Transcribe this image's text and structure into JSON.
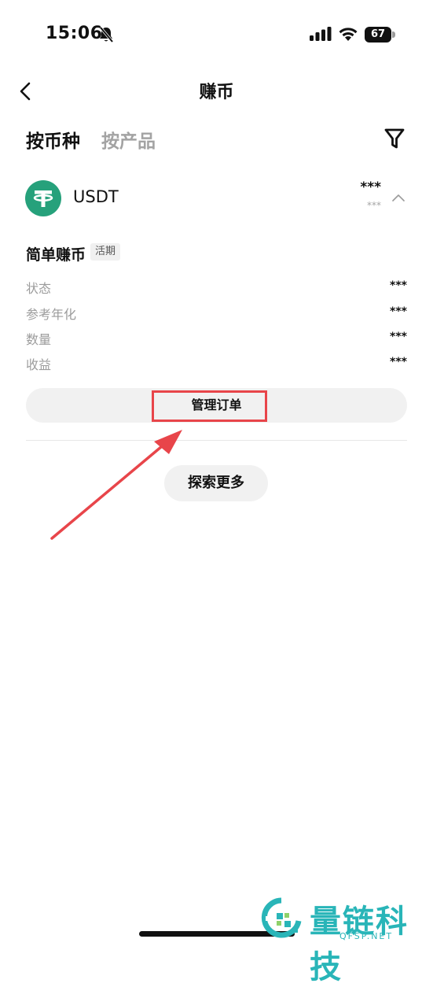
{
  "status_bar": {
    "time": "15:06",
    "battery": "67",
    "battery_level": 0.67
  },
  "nav": {
    "title": "赚币"
  },
  "tabs": [
    {
      "label": "按币种",
      "active": true
    },
    {
      "label": "按产品",
      "active": false
    }
  ],
  "coin": {
    "name": "USDT",
    "amount": "***",
    "sub_amount": "***"
  },
  "product": {
    "title": "简单赚币",
    "tag": "活期",
    "rows": [
      {
        "label": "状态",
        "value": "***"
      },
      {
        "label": "参考年化",
        "value": "***"
      },
      {
        "label": "数量",
        "value": "***"
      },
      {
        "label": "收益",
        "value": "***"
      }
    ]
  },
  "buttons": {
    "manage": "管理订单",
    "explore": "探索更多"
  },
  "colors": {
    "tether": "#26a17b",
    "highlight": "#e8454a",
    "watermark": "#29b5b8"
  },
  "icons": [
    "bell-slash-icon",
    "signal-icon",
    "wifi-icon",
    "battery-icon",
    "back-chevron-icon",
    "filter-icon",
    "tether-logo-icon",
    "chevron-up-icon",
    "arrow-annotation"
  ],
  "watermark": {
    "name": "量链科技",
    "domain": "QFSP.NET"
  }
}
